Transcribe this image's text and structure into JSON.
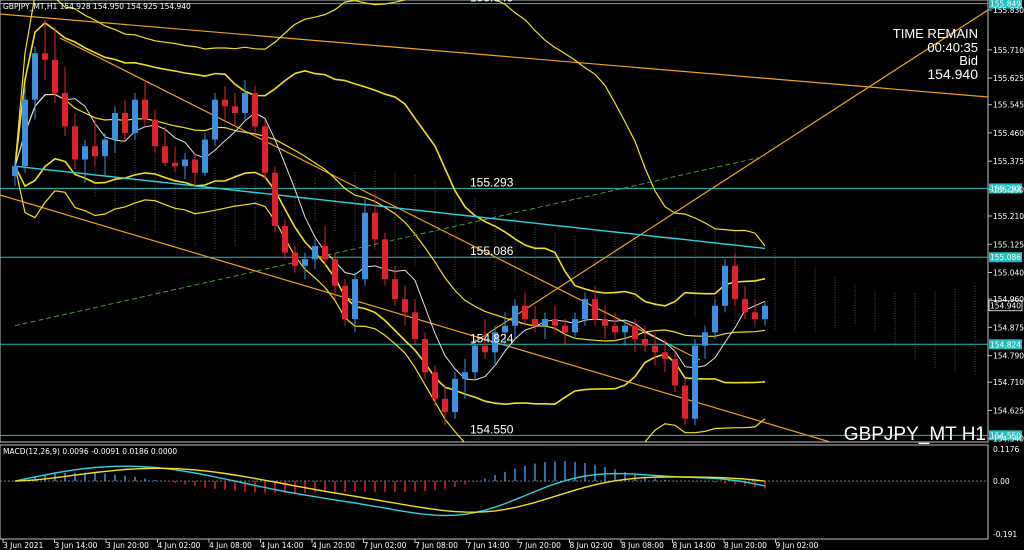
{
  "header": {
    "ohlc": "GBPJPY_MT,H1  154.928 154.950 154.925 154.940"
  },
  "hud": {
    "time_remain_label": "TIME REMAIN",
    "time_remain_value": "00:40:35",
    "bid_label": "Bid",
    "bid_value": "154.940",
    "symbol_label": "GBPJPY_MT H1"
  },
  "macd": {
    "header": "MACD(12,26,9) 0.0096 -0.0091 0.0186 0.0000",
    "ticks": [
      "0.1176",
      "0.00",
      "-0.191"
    ]
  },
  "colors": {
    "background": "#000000",
    "bull": "#3d8fe0",
    "bear": "#e0222a",
    "level_line": "#20c0c0",
    "trend_line": "#f0a020",
    "bollinger": "#f0e020",
    "ma_cyan": "#30d0e0",
    "ma_white": "#e0e0e0",
    "ma_green": "#4a9a3a",
    "macd_hist_pos": "#3d8fe0",
    "macd_hist_neg": "#e0222a",
    "macd_main": "#30d0e0",
    "macd_signal": "#f0e020"
  },
  "chart_data": {
    "type": "candlestick",
    "symbol": "GBPJPY_MT",
    "timeframe": "H1",
    "ylim": [
      154.53,
      155.86
    ],
    "y_ticks": [
      155.83,
      155.71,
      155.625,
      155.545,
      155.46,
      155.375,
      155.29,
      155.21,
      155.125,
      155.04,
      154.96,
      154.875,
      154.79,
      154.71,
      154.625,
      154.54
    ],
    "x_ticks": [
      "3 Jun 2021",
      "3 Jun 14:00",
      "3 Jun 20:00",
      "4 Jun 02:00",
      "4 Jun 08:00",
      "4 Jun 14:00",
      "4 Jun 20:00",
      "7 Jun 02:00",
      "7 Jun 08:00",
      "7 Jun 14:00",
      "7 Jun 20:00",
      "8 Jun 02:00",
      "8 Jun 08:00",
      "8 Jun 14:00",
      "8 Jun 20:00",
      "9 Jun 02:00"
    ],
    "levels": [
      {
        "label": "155.849",
        "value": 155.849
      },
      {
        "label": "155.293",
        "value": 155.293
      },
      {
        "label": "155.086",
        "value": 155.086
      },
      {
        "label": "154.824",
        "value": 154.824
      },
      {
        "label": "154.550",
        "value": 154.55
      }
    ],
    "current_price": {
      "label": "154.940",
      "value": 154.94
    },
    "candles": [
      [
        155.33,
        155.38,
        155.3,
        155.36
      ],
      [
        155.36,
        155.6,
        155.34,
        155.56
      ],
      [
        155.56,
        155.72,
        155.5,
        155.7
      ],
      [
        155.7,
        155.8,
        155.62,
        155.68
      ],
      [
        155.68,
        155.78,
        155.55,
        155.58
      ],
      [
        155.58,
        155.66,
        155.45,
        155.48
      ],
      [
        155.48,
        155.52,
        155.35,
        155.38
      ],
      [
        155.38,
        155.44,
        155.31,
        155.42
      ],
      [
        155.42,
        155.5,
        155.36,
        155.39
      ],
      [
        155.39,
        155.46,
        155.33,
        155.44
      ],
      [
        155.44,
        155.54,
        155.4,
        155.52
      ],
      [
        155.52,
        155.56,
        155.44,
        155.46
      ],
      [
        155.46,
        155.58,
        155.44,
        155.56
      ],
      [
        155.56,
        155.62,
        155.48,
        155.5
      ],
      [
        155.5,
        155.53,
        155.4,
        155.42
      ],
      [
        155.42,
        155.48,
        155.36,
        155.37
      ],
      [
        155.37,
        155.42,
        155.34,
        155.36
      ],
      [
        155.36,
        155.4,
        155.32,
        155.38
      ],
      [
        155.38,
        155.4,
        155.3,
        155.34
      ],
      [
        155.34,
        155.46,
        155.33,
        155.44
      ],
      [
        155.44,
        155.58,
        155.42,
        155.56
      ],
      [
        155.56,
        155.6,
        155.5,
        155.54
      ],
      [
        155.54,
        155.58,
        155.48,
        155.52
      ],
      [
        155.52,
        155.62,
        155.5,
        155.58
      ],
      [
        155.58,
        155.6,
        155.46,
        155.48
      ],
      [
        155.48,
        155.5,
        155.32,
        155.34
      ],
      [
        155.34,
        155.36,
        155.16,
        155.18
      ],
      [
        155.18,
        155.2,
        155.08,
        155.1
      ],
      [
        155.1,
        155.12,
        155.04,
        155.06
      ],
      [
        155.06,
        155.1,
        155.02,
        155.08
      ],
      [
        155.08,
        155.14,
        155.05,
        155.12
      ],
      [
        155.12,
        155.18,
        155.06,
        155.08
      ],
      [
        155.08,
        155.1,
        154.96,
        155.0
      ],
      [
        155.0,
        155.02,
        154.88,
        154.9
      ],
      [
        154.9,
        155.04,
        154.86,
        155.02
      ],
      [
        155.02,
        155.26,
        155.0,
        155.22
      ],
      [
        155.22,
        155.28,
        155.12,
        155.14
      ],
      [
        155.14,
        155.16,
        155.0,
        155.02
      ],
      [
        155.02,
        155.06,
        154.94,
        154.96
      ],
      [
        154.96,
        155.0,
        154.88,
        154.92
      ],
      [
        154.92,
        154.96,
        154.82,
        154.84
      ],
      [
        154.84,
        154.86,
        154.72,
        154.74
      ],
      [
        154.74,
        154.76,
        154.64,
        154.66
      ],
      [
        154.66,
        154.7,
        154.58,
        154.62
      ],
      [
        154.62,
        154.74,
        154.6,
        154.72
      ],
      [
        154.72,
        154.78,
        154.66,
        154.74
      ],
      [
        154.74,
        154.84,
        154.72,
        154.82
      ],
      [
        154.82,
        154.9,
        154.78,
        154.8
      ],
      [
        154.8,
        154.88,
        154.76,
        154.86
      ],
      [
        154.86,
        154.92,
        154.82,
        154.88
      ],
      [
        154.88,
        154.96,
        154.84,
        154.94
      ],
      [
        154.94,
        154.98,
        154.88,
        154.9
      ],
      [
        154.9,
        154.94,
        154.86,
        154.88
      ],
      [
        154.88,
        154.92,
        154.84,
        154.9
      ],
      [
        154.9,
        154.94,
        154.86,
        154.88
      ],
      [
        154.88,
        154.9,
        154.82,
        154.86
      ],
      [
        154.86,
        154.92,
        154.84,
        154.9
      ],
      [
        154.9,
        154.98,
        154.88,
        154.96
      ],
      [
        154.96,
        155.0,
        154.88,
        154.9
      ],
      [
        154.9,
        154.94,
        154.84,
        154.88
      ],
      [
        154.88,
        154.92,
        154.84,
        154.86
      ],
      [
        154.86,
        154.9,
        154.82,
        154.88
      ],
      [
        154.88,
        154.9,
        154.8,
        154.84
      ],
      [
        154.84,
        154.88,
        154.8,
        154.82
      ],
      [
        154.82,
        154.86,
        154.76,
        154.8
      ],
      [
        154.8,
        154.84,
        154.74,
        154.78
      ],
      [
        154.78,
        154.8,
        154.68,
        154.7
      ],
      [
        154.7,
        154.72,
        154.58,
        154.6
      ],
      [
        154.6,
        154.84,
        154.58,
        154.82
      ],
      [
        154.82,
        154.88,
        154.78,
        154.86
      ],
      [
        154.86,
        154.96,
        154.84,
        154.94
      ],
      [
        154.94,
        155.08,
        154.92,
        155.06
      ],
      [
        155.06,
        155.1,
        154.94,
        154.96
      ],
      [
        154.96,
        155.0,
        154.9,
        154.92
      ],
      [
        154.92,
        154.96,
        154.88,
        154.9
      ],
      [
        154.9,
        154.95,
        154.88,
        154.94
      ]
    ]
  }
}
